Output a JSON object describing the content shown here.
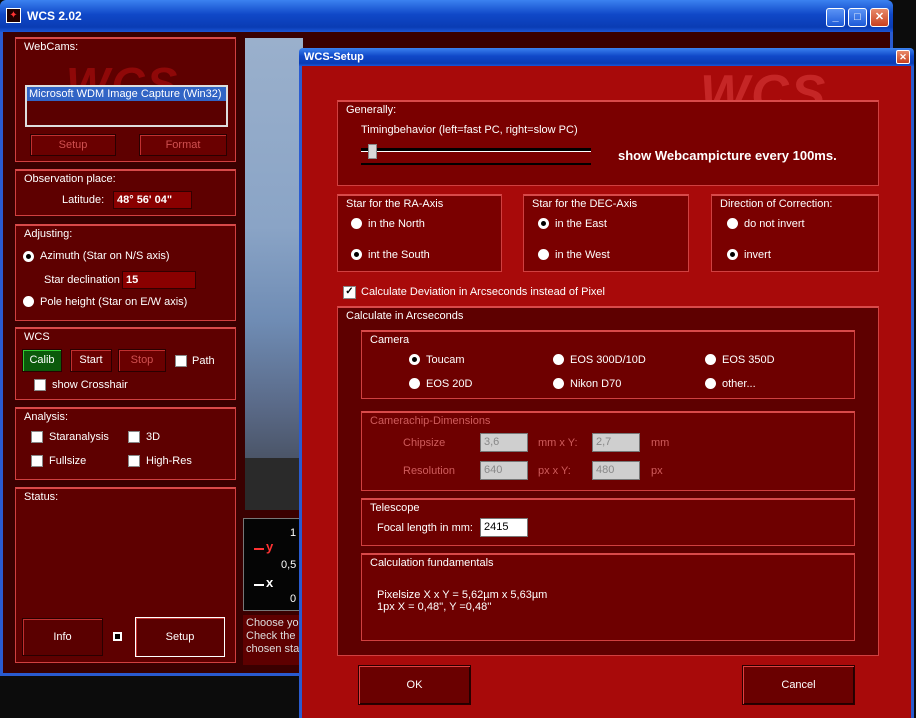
{
  "main": {
    "title": "WCS 2.02",
    "webcams": {
      "label": "WebCams:",
      "selected": "Microsoft WDM Image Capture (Win32)",
      "setup": "Setup",
      "format": "Format",
      "watermark": "WCS"
    },
    "observation": {
      "label": "Observation place:",
      "latitude_label": "Latitude:",
      "latitude": "48° 56' 04\""
    },
    "adjusting": {
      "label": "Adjusting:",
      "azimuth": "Azimuth (Star on N/S axis)",
      "declination_label": "Star declination",
      "declination": "15",
      "pole": "Pole height (Star on E/W axis)"
    },
    "wcs": {
      "label": "WCS",
      "calib": "Calib",
      "start": "Start",
      "stop": "Stop",
      "path": "Path",
      "crosshair": "show Crosshair"
    },
    "analysis": {
      "label": "Analysis:",
      "staranalysis": "Staranalysis",
      "threed": "3D",
      "fullsize": "Fullsize",
      "highres": "High-Res"
    },
    "status": {
      "label": "Status:",
      "info": "Info",
      "setup": "Setup"
    },
    "graph": {
      "y_label": "y",
      "x_label": "x",
      "t1": "1",
      "t05": "0,5",
      "t0": "0"
    },
    "hints": [
      "Choose you",
      "Check the c",
      "chosen star"
    ]
  },
  "setup": {
    "title": "WCS-Setup",
    "watermark": "WCS",
    "generally": {
      "label": "Generally:",
      "timing": "Timingbehavior (left=fast PC, right=slow PC)",
      "slider_fraction": 0.03,
      "show_text": "show Webcampicture every  100ms."
    },
    "ra_axis": {
      "label": "Star for the RA-Axis",
      "north": "in the North",
      "south": "int the South"
    },
    "dec_axis": {
      "label": "Star for the DEC-Axis",
      "east": "in the East",
      "west": "in the West"
    },
    "direction": {
      "label": "Direction of Correction:",
      "noinvert": "do not invert",
      "invert": "invert"
    },
    "calc_deviation": "Calculate Deviation in Arcseconds instead of Pixel",
    "arcsec": {
      "label": "Calculate in Arcseconds"
    },
    "camera": {
      "label": "Camera",
      "toucam": "Toucam",
      "eos300": "EOS 300D/10D",
      "eos350": "EOS 350D",
      "eos20": "EOS 20D",
      "nikon": "Nikon D70",
      "other": "other..."
    },
    "chip": {
      "label": "Camerachip-Dimensions",
      "chipsize_label": "Chipsize",
      "chip_x": "3,6",
      "mm_x_y": "mm x Y:",
      "chip_y": "2,7",
      "mm": "mm",
      "res_label": "Resolution",
      "res_x": "640",
      "px_x_y": "px x Y:",
      "res_y": "480",
      "px": "px"
    },
    "telescope": {
      "label": "Telescope",
      "focal_label": "Focal length in mm:",
      "focal": "2415"
    },
    "fundamentals": {
      "label": "Calculation fundamentals",
      "line1": "Pixelsize X x Y = 5,62µm x 5,63µm",
      "line2": "1px X = 0,48'', Y =0,48''"
    },
    "ok": "OK",
    "cancel": "Cancel"
  }
}
